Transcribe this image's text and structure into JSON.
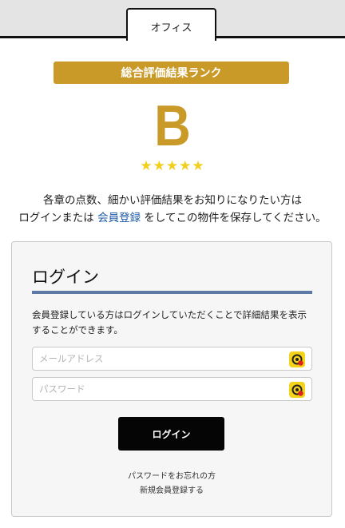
{
  "tabs": [
    {
      "label": "オフィス"
    }
  ],
  "rank": {
    "banner_label": "総合評価結果ランク",
    "grade": "B",
    "stars": "★★★★★",
    "star_count": 5,
    "star_color": "#f2cf1b",
    "accent_color": "#c99a28"
  },
  "description": {
    "line1": "各章の点数、細かい評価結果をお知りになりたい方は",
    "line2_prefix": "ログインまたは ",
    "register_link": "会員登録",
    "line2_suffix": " をしてこの物件を保存してください。"
  },
  "login": {
    "title": "ログイン",
    "note": "会員登録している方はログインしていただくことで詳細結果を表示することができます。",
    "email_placeholder": "メールアドレス",
    "password_placeholder": "パスワード",
    "field_icon": "key-autofill-icon",
    "submit_label": "ログイン",
    "forgot_password": "パスワードをお忘れの方",
    "register": "新規会員登録する"
  }
}
